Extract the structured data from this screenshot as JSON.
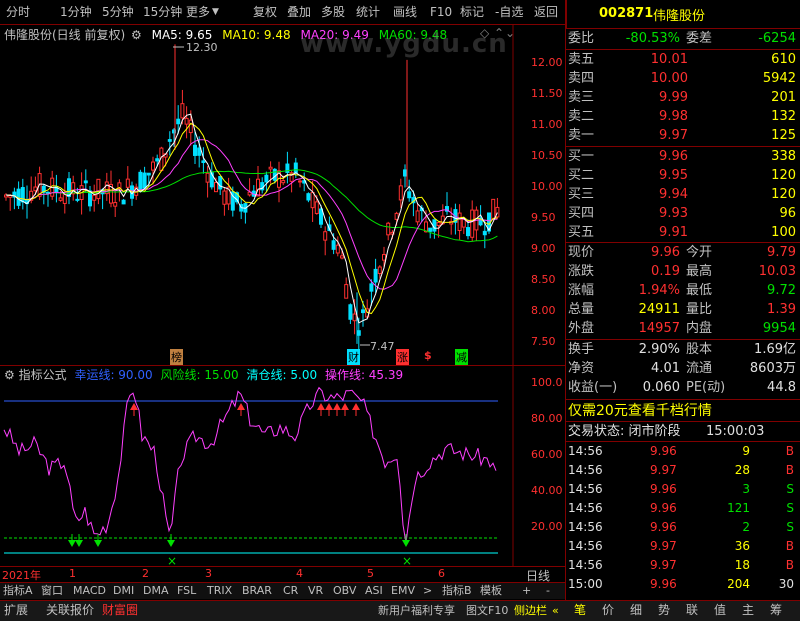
{
  "toolbar": {
    "items": [
      "分时",
      "1分钟",
      "5分钟",
      "15分钟",
      "更多",
      "复权",
      "叠加",
      "多股",
      "统计",
      "画线",
      "F10",
      "标记",
      "-自选",
      "返回"
    ]
  },
  "chart": {
    "title": "伟隆股份(日线 前复权)",
    "ma5": "MA5: 9.65",
    "ma10": "MA10: 9.48",
    "ma20": "MA20: 9.49",
    "ma60": "MA60: 9.48",
    "high_label": "12.30",
    "low_label": "7.47",
    "price_axis": [
      "12.00",
      "11.50",
      "11.00",
      "10.50",
      "10.00",
      "9.50",
      "9.00",
      "8.50",
      "8.00",
      "7.50"
    ],
    "markers": {
      "bang": "榜",
      "cai": "财",
      "zhang": "涨",
      "dollar": "$",
      "jian": "减"
    },
    "watermark": "www.ygdu.cn",
    "colors": {
      "up": "#ff3030",
      "down": "#00e0ff",
      "ma5": "#ffffff",
      "ma10": "#ffff00",
      "ma20": "#ff40ff",
      "ma60": "#00e000"
    }
  },
  "indicator": {
    "name": "指标公式",
    "l1": "幸运线: 90.00",
    "l2": "风险线: 15.00",
    "l3": "清仓线: 5.00",
    "l4": "操作线: 45.39",
    "axis": [
      "100.0",
      "80.00",
      "60.00",
      "40.00",
      "20.00"
    ]
  },
  "time_axis": {
    "year": "2021年",
    "months": [
      "1",
      "2",
      "3",
      "4",
      "5",
      "6"
    ],
    "period": "日线"
  },
  "tabs": [
    "指标A",
    "窗口",
    "MACD",
    "DMI",
    "DMA",
    "FSL",
    "TRIX",
    "BRAR",
    "CR",
    "VR",
    "OBV",
    "ASI",
    "EMV",
    ">",
    "指标B",
    "模板",
    "+",
    "-"
  ],
  "bottom": {
    "left": [
      "扩展",
      "关联报价",
      "财富圈"
    ],
    "promo": "新用户福利专享",
    "news": "图文F10",
    "side": "侧边栏",
    "right_tabs": [
      "笔",
      "价",
      "细",
      "势",
      "联",
      "值",
      "主",
      "筹"
    ]
  },
  "stock": {
    "code": "002871",
    "name": "伟隆股份"
  },
  "weibi": {
    "l1": "委比",
    "v1": "-80.53%",
    "l2": "委差",
    "v2": "-6254"
  },
  "asks": [
    {
      "label": "卖五",
      "price": "10.01",
      "vol": "610"
    },
    {
      "label": "卖四",
      "price": "10.00",
      "vol": "5942"
    },
    {
      "label": "卖三",
      "price": "9.99",
      "vol": "201"
    },
    {
      "label": "卖二",
      "price": "9.98",
      "vol": "132"
    },
    {
      "label": "卖一",
      "price": "9.97",
      "vol": "125"
    }
  ],
  "bids": [
    {
      "label": "买一",
      "price": "9.96",
      "vol": "338"
    },
    {
      "label": "买二",
      "price": "9.95",
      "vol": "120"
    },
    {
      "label": "买三",
      "price": "9.94",
      "vol": "120"
    },
    {
      "label": "买四",
      "price": "9.93",
      "vol": "96"
    },
    {
      "label": "买五",
      "price": "9.91",
      "vol": "100"
    }
  ],
  "quote": [
    {
      "l": "现价",
      "v": "9.96",
      "l2": "今开",
      "v2": "9.79"
    },
    {
      "l": "涨跌",
      "v": "0.19",
      "l2": "最高",
      "v2": "10.03"
    },
    {
      "l": "涨幅",
      "v": "1.94%",
      "l2": "最低",
      "v2": "9.72"
    },
    {
      "l": "总量",
      "v": "24911",
      "l2": "量比",
      "v2": "1.39"
    },
    {
      "l": "外盘",
      "v": "14957",
      "l2": "内盘",
      "v2": "9954"
    }
  ],
  "fund": [
    {
      "l": "换手",
      "v": "2.90%",
      "l2": "股本",
      "v2": "1.69亿"
    },
    {
      "l": "净资",
      "v": "4.01",
      "l2": "流通",
      "v2": "8603万"
    },
    {
      "l": "收益(一)",
      "v": "0.060",
      "l2": "PE(动)",
      "v2": "44.8"
    }
  ],
  "ad": "仅需20元查看千档行情",
  "status": {
    "label": "交易状态: 闭市阶段",
    "time": "15:00:03"
  },
  "ticks": [
    {
      "t": "14:56",
      "p": "9.96",
      "v": "9",
      "s": "B"
    },
    {
      "t": "14:56",
      "p": "9.97",
      "v": "28",
      "s": "B"
    },
    {
      "t": "14:56",
      "p": "9.96",
      "v": "3",
      "s": "S"
    },
    {
      "t": "14:56",
      "p": "9.96",
      "v": "121",
      "s": "S"
    },
    {
      "t": "14:56",
      "p": "9.96",
      "v": "2",
      "s": "S"
    },
    {
      "t": "14:56",
      "p": "9.97",
      "v": "36",
      "s": "B"
    },
    {
      "t": "14:56",
      "p": "9.97",
      "v": "18",
      "s": "B"
    },
    {
      "t": "15:00",
      "p": "9.96",
      "v": "204",
      "s": "30"
    }
  ]
}
